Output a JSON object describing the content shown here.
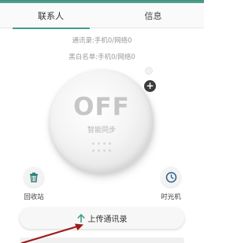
{
  "tabs": [
    {
      "label": "联系人",
      "active": true
    },
    {
      "label": "信息",
      "active": false
    }
  ],
  "status": {
    "contacts_line": "通讯录:手机0/网络0",
    "blacklist_line": "黑白名单:手机0/网络0"
  },
  "sync_knob": {
    "state_label": "OFF",
    "subtitle": "智能同步"
  },
  "actions": {
    "recycle_label": "回收站",
    "time_machine_label": "时光机",
    "upload_label": "上传通讯录"
  },
  "icons": {
    "recycle": "trash-icon",
    "time_machine": "clock-icon",
    "upload": "arrow-up-icon",
    "add": "plus-icon"
  },
  "colors": {
    "accent": "#3f9d8a",
    "annotation_arrow": "#9b1c1c"
  }
}
